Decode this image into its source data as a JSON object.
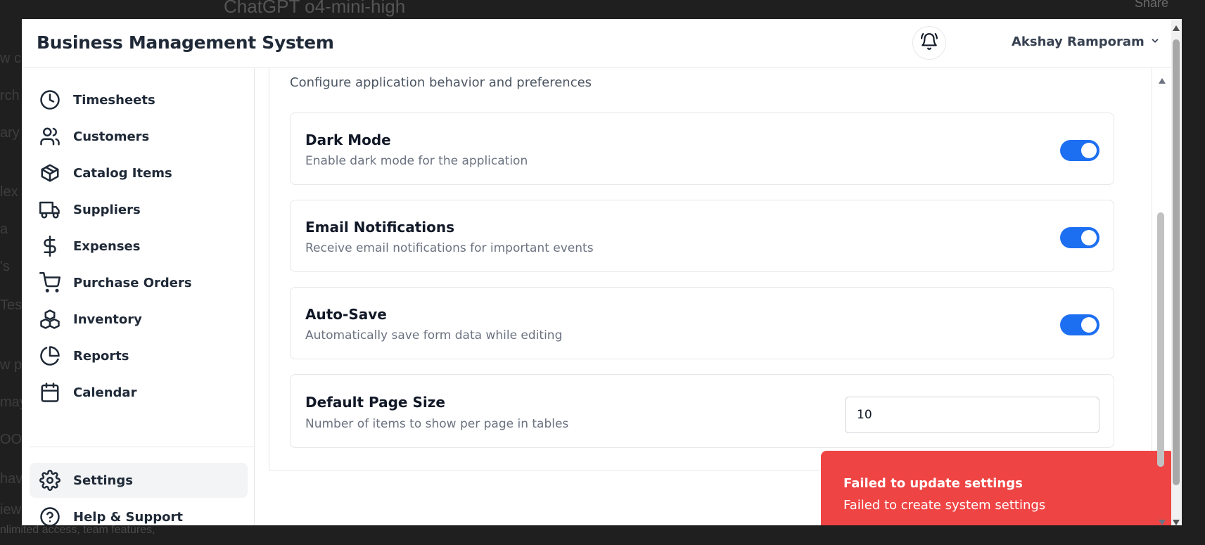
{
  "background": {
    "title": "ChatGPT o4-mini-high",
    "share": "Share",
    "left_fragments": [
      "w ch",
      "rch",
      "ary",
      "lex",
      "a",
      "'s",
      "Tes",
      "w pr",
      "may",
      "OOK",
      "hav",
      "iew"
    ],
    "bottom_text": "nlimited access, team features,"
  },
  "header": {
    "app_title": "Business Management System",
    "bell_icon": "bell-icon",
    "user_name": "Akshay Ramporam",
    "user_chevron": "chevron-down-icon"
  },
  "sidebar": {
    "items": [
      {
        "label": "Timesheets",
        "icon": "clock-icon"
      },
      {
        "label": "Customers",
        "icon": "users-icon"
      },
      {
        "label": "Catalog Items",
        "icon": "package-icon"
      },
      {
        "label": "Suppliers",
        "icon": "truck-icon"
      },
      {
        "label": "Expenses",
        "icon": "dollar-icon"
      },
      {
        "label": "Purchase Orders",
        "icon": "cart-icon"
      },
      {
        "label": "Inventory",
        "icon": "boxes-icon"
      },
      {
        "label": "Reports",
        "icon": "pie-chart-icon"
      },
      {
        "label": "Calendar",
        "icon": "calendar-icon"
      }
    ],
    "bottom_items": [
      {
        "label": "Settings",
        "icon": "gear-icon",
        "active": true
      },
      {
        "label": "Help & Support",
        "icon": "help-circle-icon",
        "active": false
      }
    ]
  },
  "main": {
    "subtitle": "Configure application behavior and preferences",
    "settings": [
      {
        "title": "Dark Mode",
        "description": "Enable dark mode for the application",
        "enabled": true
      },
      {
        "title": "Email Notifications",
        "description": "Receive email notifications for important events",
        "enabled": true
      },
      {
        "title": "Auto-Save",
        "description": "Automatically save form data while editing",
        "enabled": true
      }
    ],
    "page_size": {
      "title": "Default Page Size",
      "description": "Number of items to show per page in tables",
      "value": "10"
    }
  },
  "toast": {
    "title": "Failed to update settings",
    "message": "Failed to create system settings"
  },
  "colors": {
    "accent": "#1d6ff2",
    "error": "#ef4444",
    "active_nav": "#f3f4f6"
  }
}
